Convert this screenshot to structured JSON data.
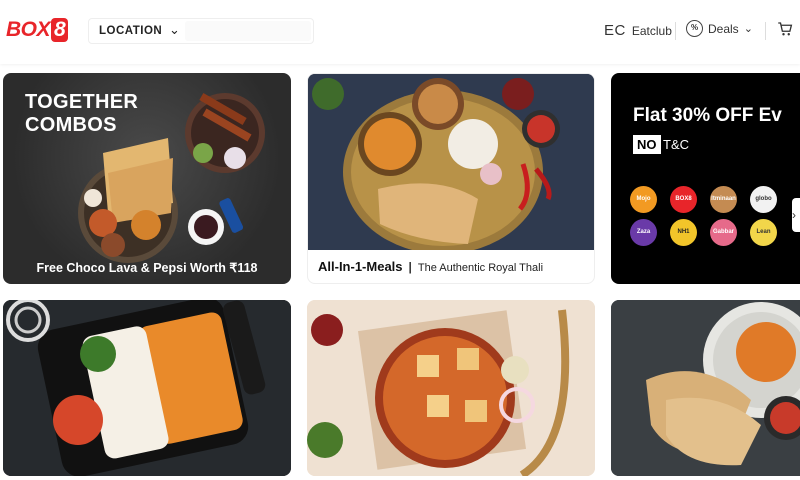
{
  "header": {
    "logo_text": "BOX",
    "logo_num": "8",
    "location_label": "LOCATION",
    "location_value": "",
    "eatclub_mark": "EC",
    "eatclub_label": "Eatclub",
    "deals_label": "Deals"
  },
  "banners": {
    "together": {
      "title_line1": "TOGETHER",
      "title_line2": "COMBOS",
      "caption": "Free Choco Lava & Pepsi Worth ₹118"
    },
    "thali": {
      "bold": "All-In-1-Meals",
      "divider": "|",
      "sub": "The Authentic Royal Thali"
    },
    "offer": {
      "title": "Flat 30% OFF Ev",
      "no": "NO",
      "tc": "T&C",
      "brands": [
        "Mojo",
        "BOX8",
        "Itminaan Biryani",
        "globo",
        "Zaza",
        "NH1 Bowls",
        "Gabbar Rolls",
        "Lean Crust Pizza"
      ]
    }
  },
  "colors": {
    "brand_red": "#e8252a"
  },
  "icons": [
    "chevron-down-icon",
    "deals-percent-icon",
    "cart-icon",
    "chevron-right-icon"
  ]
}
